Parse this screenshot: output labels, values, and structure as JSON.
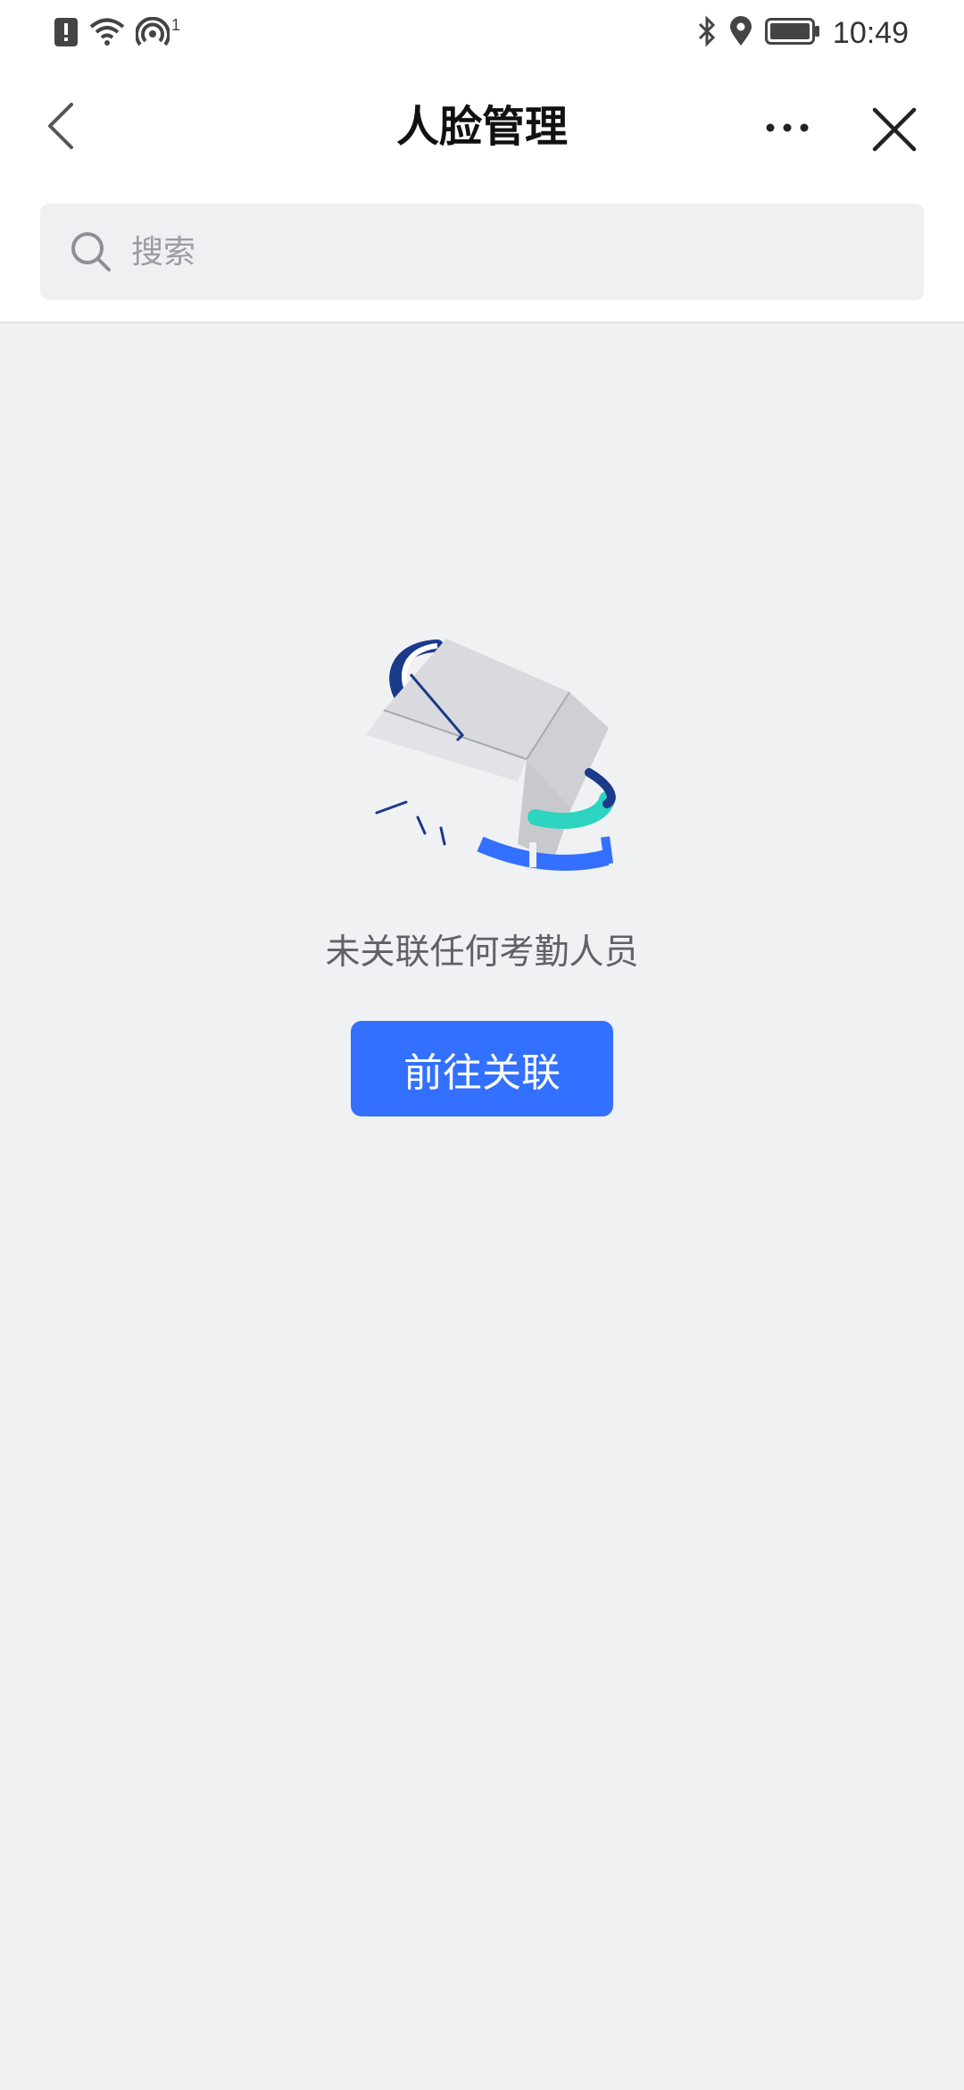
{
  "status_bar": {
    "time": "10:49",
    "hotspot_superscript": "1",
    "icons": [
      "alert-icon",
      "wifi-icon",
      "hotspot-icon",
      "bluetooth-icon",
      "location-icon",
      "battery-icon"
    ]
  },
  "header": {
    "title": "人脸管理",
    "back_icon": "chevron-left-icon",
    "more_icon": "more-horizontal-icon",
    "close_icon": "close-icon"
  },
  "search": {
    "placeholder": "搜索",
    "value": ""
  },
  "empty_state": {
    "illustration": "empty-box-illustration",
    "message": "未关联任何考勤人员",
    "button_label": "前往关联"
  },
  "colors": {
    "primary": "#3370ff",
    "page_background": "#f0f1f3",
    "header_background": "#ffffff",
    "teal_accent": "#2dd4bf",
    "navy_accent": "#1a3a8a"
  }
}
